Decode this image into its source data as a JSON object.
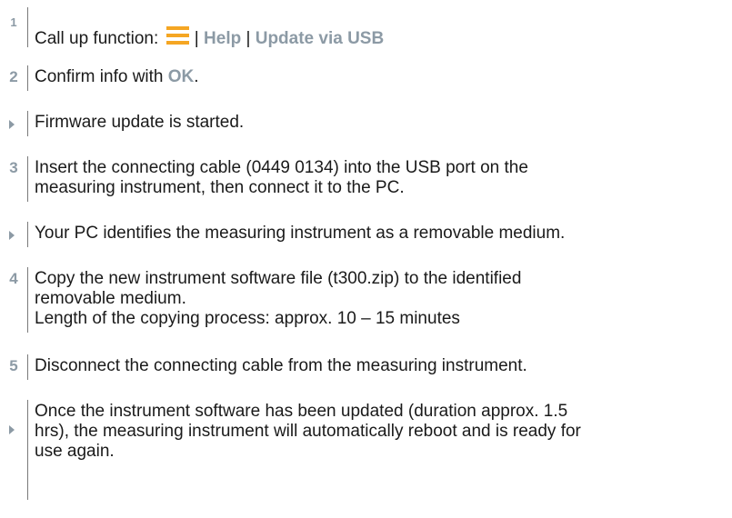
{
  "steps": [
    {
      "marker": "1",
      "text_prefix": "Call up function: ",
      "sep1": " | ",
      "help": "Help",
      "sep2": " | ",
      "update": "Update via USB"
    },
    {
      "marker": "2",
      "text_prefix": "Confirm info with ",
      "ok": "OK",
      "text_suffix": "."
    },
    {
      "result": "Firmware update is started."
    },
    {
      "marker": "3",
      "line1": "Insert the connecting cable (0449 0134) into the USB port on the",
      "line2": "measuring instrument, then connect it to the PC."
    },
    {
      "result": "Your PC identifies the measuring instrument as a removable medium."
    },
    {
      "marker": "4",
      "line1": "Copy the new instrument software file (t300.zip) to the identified",
      "line2": "removable medium.",
      "line3": "Length of the copying process: approx. 10 – 15 minutes"
    },
    {
      "marker": "5",
      "text": "Disconnect the connecting cable from the measuring instrument."
    },
    {
      "result_lines": [
        "Once the instrument software has been updated (duration approx. 1.5",
        "hrs), the measuring instrument will automatically reboot and is ready for",
        "use again."
      ]
    }
  ],
  "colors": {
    "accent": "#8c9aa5",
    "icon_orange": "#f5a623"
  },
  "icons": {
    "menu": "menu-lines-icon",
    "result": "result-triangle-icon"
  }
}
